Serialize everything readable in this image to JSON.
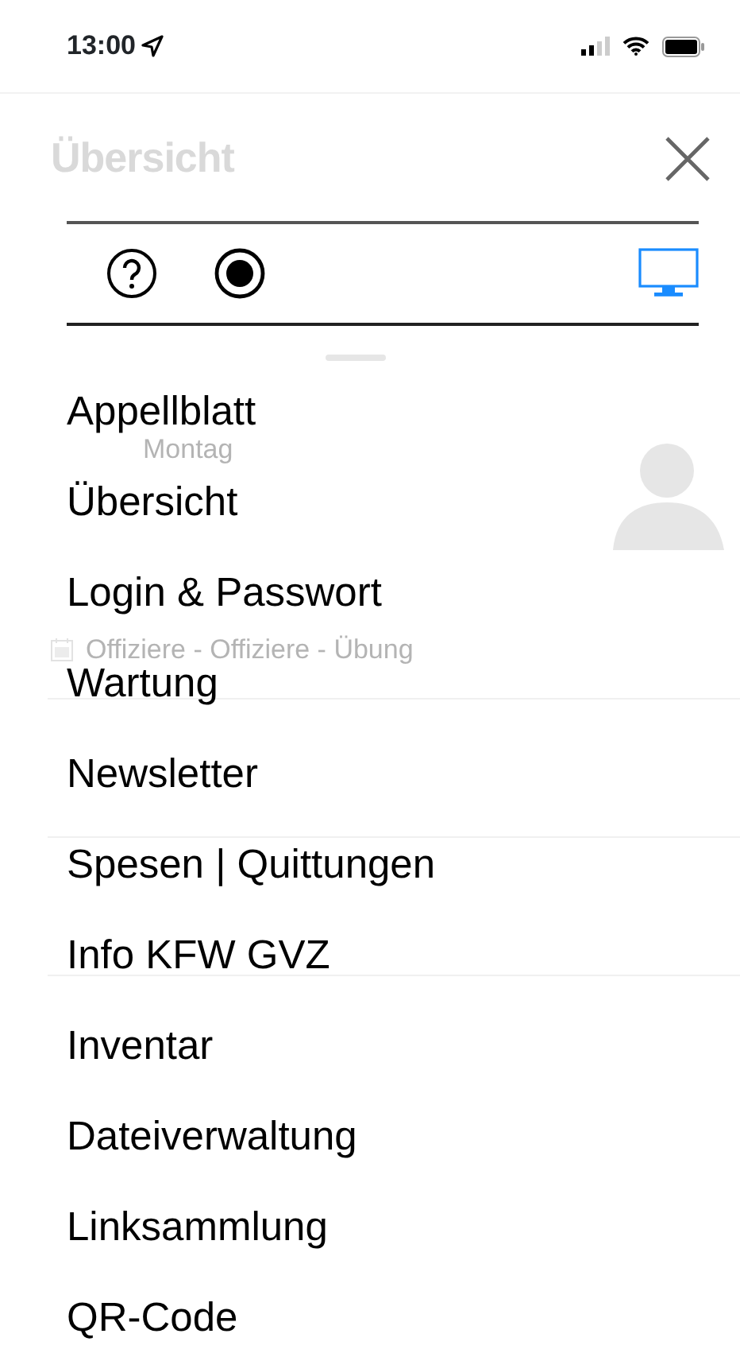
{
  "status_bar": {
    "time": "13:00"
  },
  "header": {
    "title": "Übersicht"
  },
  "background": {
    "day_name": "Montag",
    "event": "Offiziere - Offiziere - Übung"
  },
  "toolbar": {
    "buttons": [
      {
        "kind": "help",
        "selected": false
      },
      {
        "kind": "record",
        "selected": false
      },
      {
        "kind": "monitor",
        "selected": true
      }
    ]
  },
  "menu": {
    "items": [
      {
        "label": "Appellblatt"
      },
      {
        "label": "Übersicht"
      },
      {
        "label": "Login & Passwort"
      },
      {
        "label": "Wartung"
      },
      {
        "label": "Newsletter"
      },
      {
        "label": "Spesen | Quittungen"
      },
      {
        "label": "Info KFW GVZ"
      },
      {
        "label": "Inventar"
      },
      {
        "label": "Dateiverwaltung"
      },
      {
        "label": "Linksammlung"
      },
      {
        "label": "QR-Code"
      }
    ]
  }
}
